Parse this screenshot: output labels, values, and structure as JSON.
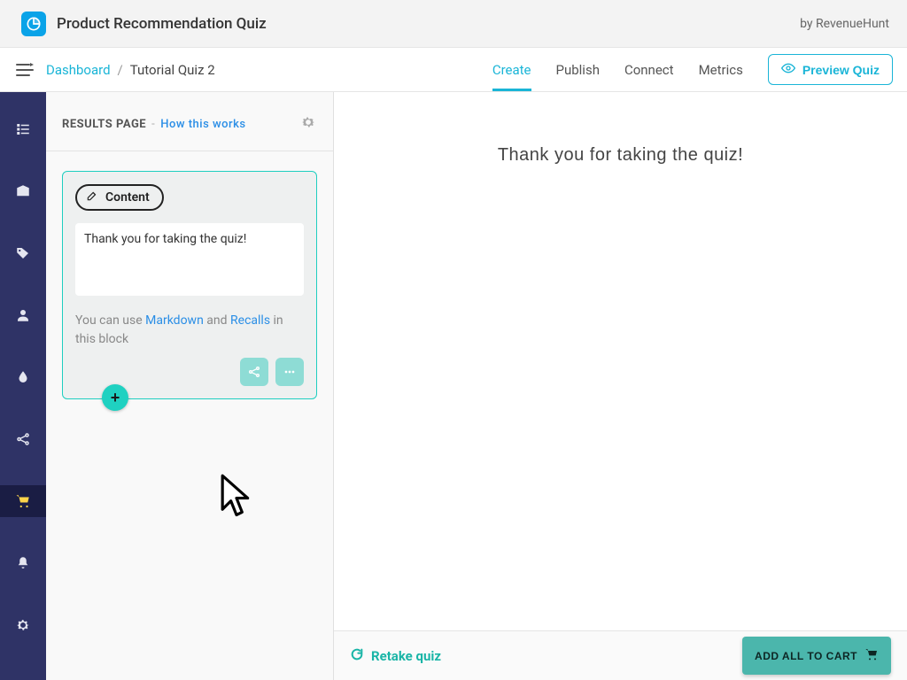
{
  "header": {
    "app_title": "Product Recommendation Quiz",
    "by_line": "by RevenueHunt"
  },
  "breadcrumb": {
    "dashboard": "Dashboard",
    "current": "Tutorial Quiz 2"
  },
  "tabs": {
    "create": "Create",
    "publish": "Publish",
    "connect": "Connect",
    "metrics": "Metrics",
    "active": "create"
  },
  "preview_button": "Preview Quiz",
  "rail": {
    "items": [
      {
        "name": "list-icon"
      },
      {
        "name": "box-icon"
      },
      {
        "name": "tag-icon"
      },
      {
        "name": "user-icon"
      },
      {
        "name": "drop-icon"
      },
      {
        "name": "share-icon"
      },
      {
        "name": "cart-icon",
        "active": true
      },
      {
        "name": "bell-icon"
      },
      {
        "name": "gear-icon"
      }
    ]
  },
  "results_panel": {
    "title": "RESULTS PAGE",
    "how_link": "How this works",
    "content_chip": "Content",
    "editor_value": "Thank you for taking the quiz!",
    "hint_prefix": "You can use ",
    "markdown": "Markdown",
    "hint_mid": " and ",
    "recalls": "Recalls",
    "hint_suffix": " in this block",
    "add_label": "+"
  },
  "preview": {
    "heading": "Thank you for taking the quiz!",
    "retake": "Retake quiz",
    "add_all": "ADD ALL TO CART"
  },
  "colors": {
    "accent": "#1ab5d7",
    "rail_bg": "#2f3366",
    "teal": "#1fd1c1",
    "cart_btn": "#4bb6ac"
  }
}
